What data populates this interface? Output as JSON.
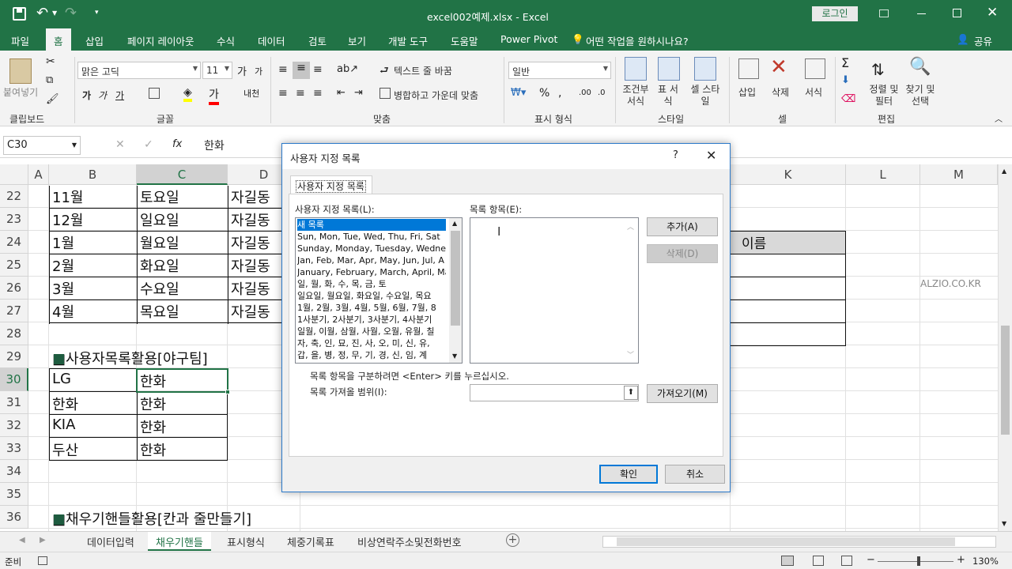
{
  "window": {
    "title": "excel002예제.xlsx  -  Excel",
    "login": "로그인",
    "share": "공유",
    "tell_me": "어떤 작업을 원하시나요?"
  },
  "tabs": [
    "파일",
    "홈",
    "삽입",
    "페이지 레이아웃",
    "수식",
    "데이터",
    "검토",
    "보기",
    "개발 도구",
    "도움말",
    "Power Pivot"
  ],
  "ribbon": {
    "paste": "붙여넣기",
    "font_name": "맑은 고딕",
    "font_size": "11",
    "wrap_text": "텍스트 줄 바꿈",
    "merge_center": "병합하고 가운데 맞춤",
    "number_format": "일반",
    "cond_format": "조건부 서식",
    "format_table": "표 서식",
    "cell_styles": "셀 스타일",
    "insert": "삽입",
    "delete": "삭제",
    "format": "서식",
    "sort_filter": "정렬 및 필터",
    "find_select": "찾기 및 선택",
    "groups": {
      "clipboard": "클립보드",
      "font": "글꼴",
      "alignment": "맞춤",
      "number": "표시 형식",
      "styles": "스타일",
      "cells": "셀",
      "editing": "편집"
    }
  },
  "formula_bar": {
    "name_box": "C30",
    "value": "한화"
  },
  "columns": [
    "A",
    "B",
    "C",
    "D",
    "K",
    "L",
    "M"
  ],
  "rows": [
    "22",
    "23",
    "24",
    "25",
    "26",
    "27",
    "28",
    "29",
    "30",
    "31",
    "32",
    "33",
    "34",
    "35",
    "36"
  ],
  "cells": {
    "b22": "11월",
    "c22": "토요일",
    "d22": "자길동",
    "b23": "12월",
    "c23": "일요일",
    "d23": "자길동",
    "b24": "1월",
    "c24": "월요일",
    "d24": "자길동",
    "b25": "2월",
    "c25": "화요일",
    "d25": "자길동",
    "b26": "3월",
    "c26": "수요일",
    "d26": "자길동",
    "b27": "4월",
    "c27": "목요일",
    "d27": "자길동",
    "b29": "■사용자목록활용[야구팀]",
    "b30": "LG",
    "c30": "한화",
    "b31": "한화",
    "c31": "한화",
    "b32": "KIA",
    "c32": "한화",
    "b33": "두산",
    "c33": "한화",
    "b36": "■채우기핸들활용[칸과 줄만들기]",
    "k24": "이름",
    "watermark": "ALZIO.CO.KR"
  },
  "sheets": [
    "데이터입력",
    "채우기핸들",
    "표시형식",
    "체중기록표",
    "비상연락주소및전화번호"
  ],
  "status": {
    "ready": "준비",
    "zoom": "130%"
  },
  "dialog": {
    "title": "사용자 지정 목록",
    "help": "?",
    "tab": "사용자 지정 목록",
    "lists_label": "사용자 지정 목록(L):",
    "entries_label": "목록 항목(E):",
    "lists": [
      "새 목록",
      "Sun, Mon, Tue, Wed, Thu, Fri, Sat",
      "Sunday, Monday, Tuesday, Wednes",
      "Jan, Feb, Mar, Apr, May, Jun, Jul, A",
      "January, February, March, April, Ma",
      "일, 월, 화, 수, 목, 금, 토",
      "일요일, 월요일, 화요일, 수요일, 목요",
      "1월, 2월, 3월, 4월, 5월, 6월, 7월, 8",
      "1사분기, 2사분기, 3사분기, 4사분기",
      "일월, 이월, 삼월, 사월, 오월, 유월, 칠",
      "자, 축, 인, 묘, 진, 사, 오, 미, 신, 유,",
      "갑, 을, 병, 정, 무, 기, 경, 신, 임, 계"
    ],
    "add": "추가(A)",
    "delete": "삭제(D)",
    "hint": "목록 항목을 구분하려면 <Enter> 키를 누르십시오.",
    "import_label": "목록 가져올 범위(I):",
    "import_btn": "가져오기(M)",
    "ok": "확인",
    "cancel": "취소"
  }
}
